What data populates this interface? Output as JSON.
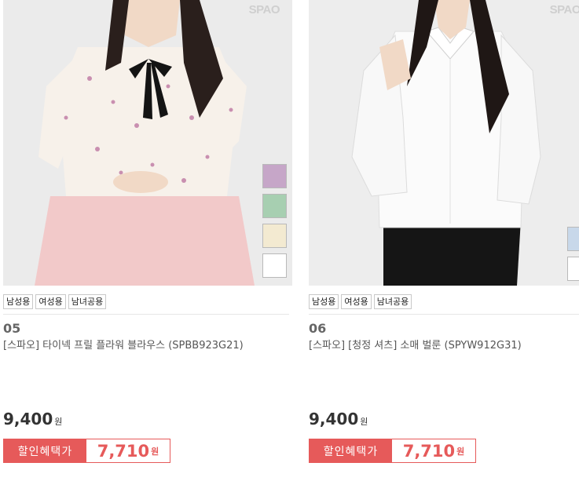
{
  "products": [
    {
      "brand": "SPAO",
      "number": "05",
      "name": "[스파오] 타이넥 프릴 플라워 블라우스 (SPBB923G21)",
      "tags": [
        "남성용",
        "여성용",
        "남녀공용"
      ],
      "price": "9,400",
      "price_unit": "원",
      "benefit_label": "할인혜택가",
      "benefit_price": "7,710",
      "benefit_unit": "원",
      "swatches": [
        "#c6a6c8",
        "#a7cfb1",
        "#f3ead1",
        "#ffffff"
      ]
    },
    {
      "brand": "SPAO",
      "number": "06",
      "name": "[스파오] [청정 셔츠] 소매 벌룬 (SPYW912G31)",
      "tags": [
        "남성용",
        "여성용",
        "남녀공용"
      ],
      "price": "9,400",
      "price_unit": "원",
      "benefit_label": "할인혜택가",
      "benefit_price": "7,710",
      "benefit_unit": "원",
      "swatches": [
        "#c8d8ea",
        "#ffffff"
      ]
    }
  ]
}
